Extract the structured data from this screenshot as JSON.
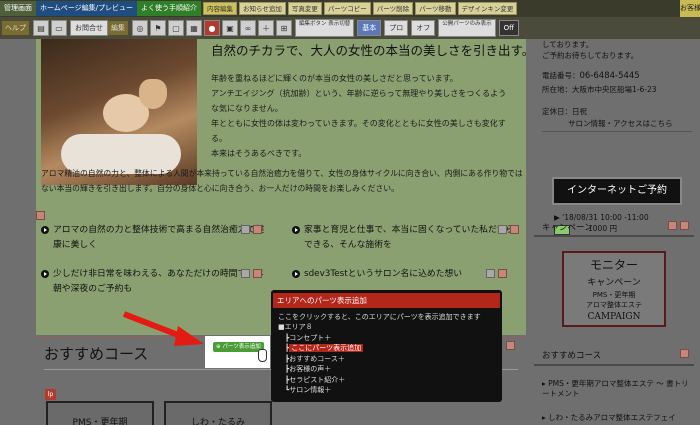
{
  "topbar": {
    "admin": "管理画面",
    "home_edit": "ホームページ編集/プレビュー",
    "frequent": "よく使う手順紹介",
    "buttons": [
      "内容編集",
      "お知らせ追加",
      "写真変更",
      "パーツコピー",
      "パーツ削除",
      "パーツ移動",
      "デザインキン変更"
    ],
    "guest": "お客様ID"
  },
  "subbar": {
    "help": "ヘルプ",
    "contact": "お問合せ",
    "edit": "編集",
    "area_toggle": "編集ボタン 表示切替",
    "basic": "基本",
    "pro": "プロ",
    "off": "オフ",
    "public_only": "公開パーツのみ表示",
    "off2": "Off"
  },
  "main": {
    "headline": "自然のチカラで、大人の女性の本当の美しさを引き出す。",
    "para1": "年齢を重ねるほどに輝くのが本当の女性の美しさだと思っています。",
    "para2": "アンチエイジング（抗加齢）という、年齢に逆らって無理やり美しさをつくるような気になりません。",
    "para3": "年とともに女性の体は変わっていきます。その変化とともに女性の美しさも変化する。",
    "para4": "本来はそうあるべきです。",
    "wide": "アロマ精油の自然の力と、整体による人間が本来持っている自然治癒力を借りて、女性の身体サイクルに向き合い、内側にある作り物ではない本当の輝きを引き出します。自分の身体と心に向き合う、お一人だけの時間をお楽しみください。",
    "features": [
      "アロマの自然の力と整体技術で高まる自然治癒力で健康に美しく",
      "家事と育児と仕事で、本当に固くなっていた私だからできる、そんな施術を",
      "少しだけ非日常を味わえる、あなただけの時間で、早朝や深夜のご予約も",
      "sdev3Testというサロン名に込めた想い"
    ]
  },
  "recommend": {
    "title": "おすすめコース",
    "cards": [
      "PMS・更年期",
      "しわ・たるみ"
    ],
    "lp": "lp"
  },
  "add_button": {
    "label": "パーツ表示追加"
  },
  "popup": {
    "header": "エリアへのパーツ表示追加",
    "desc": "ここをクリックすると、このエリアにパーツを表示追加できます",
    "tree": [
      {
        "label": "エリア８",
        "level": 0,
        "highlight": false
      },
      {
        "label": "コンセプト",
        "level": 1,
        "highlight": false
      },
      {
        "label": "ここにパーツ表示追加",
        "level": 1,
        "highlight": true
      },
      {
        "label": "おすすめコース",
        "level": 1,
        "highlight": false
      },
      {
        "label": "お客様の声",
        "level": 1,
        "highlight": false
      },
      {
        "label": "セラピスト紹介",
        "level": 1,
        "highlight": false
      },
      {
        "label": "サロン情報",
        "level": 1,
        "highlight": false
      }
    ]
  },
  "side": {
    "intro1": "しております。",
    "intro2": "ご予約お待ちしております。",
    "phone_label": "電話番号：",
    "phone": "06-6484-5445",
    "addr_label": "所在地",
    "addr": "：大阪市中央区船場1-6-23",
    "closed_label": "定休日",
    "closed": "：日祝",
    "salon_link": "サロン情報・アクセスはこちら",
    "net_booking": "インターネットご予約",
    "slot_date": "'18/08/31 10:00 -11:00",
    "slot_price": "1000 円",
    "campaign_hdr": "キャンペーン",
    "camp_title": "モニター",
    "camp_sub": "キャンペーン",
    "camp_l1": "PMS・更年期",
    "camp_l2": "アロマ整体エステ",
    "camp_word": "CAMPAIGN",
    "reco_hdr": "おすすめコース",
    "reco_items": [
      "PMS・更年期アロマ整体エステ ～ 書トリートメント",
      "しわ・たるみアロマ整体エステフェイ"
    ]
  }
}
